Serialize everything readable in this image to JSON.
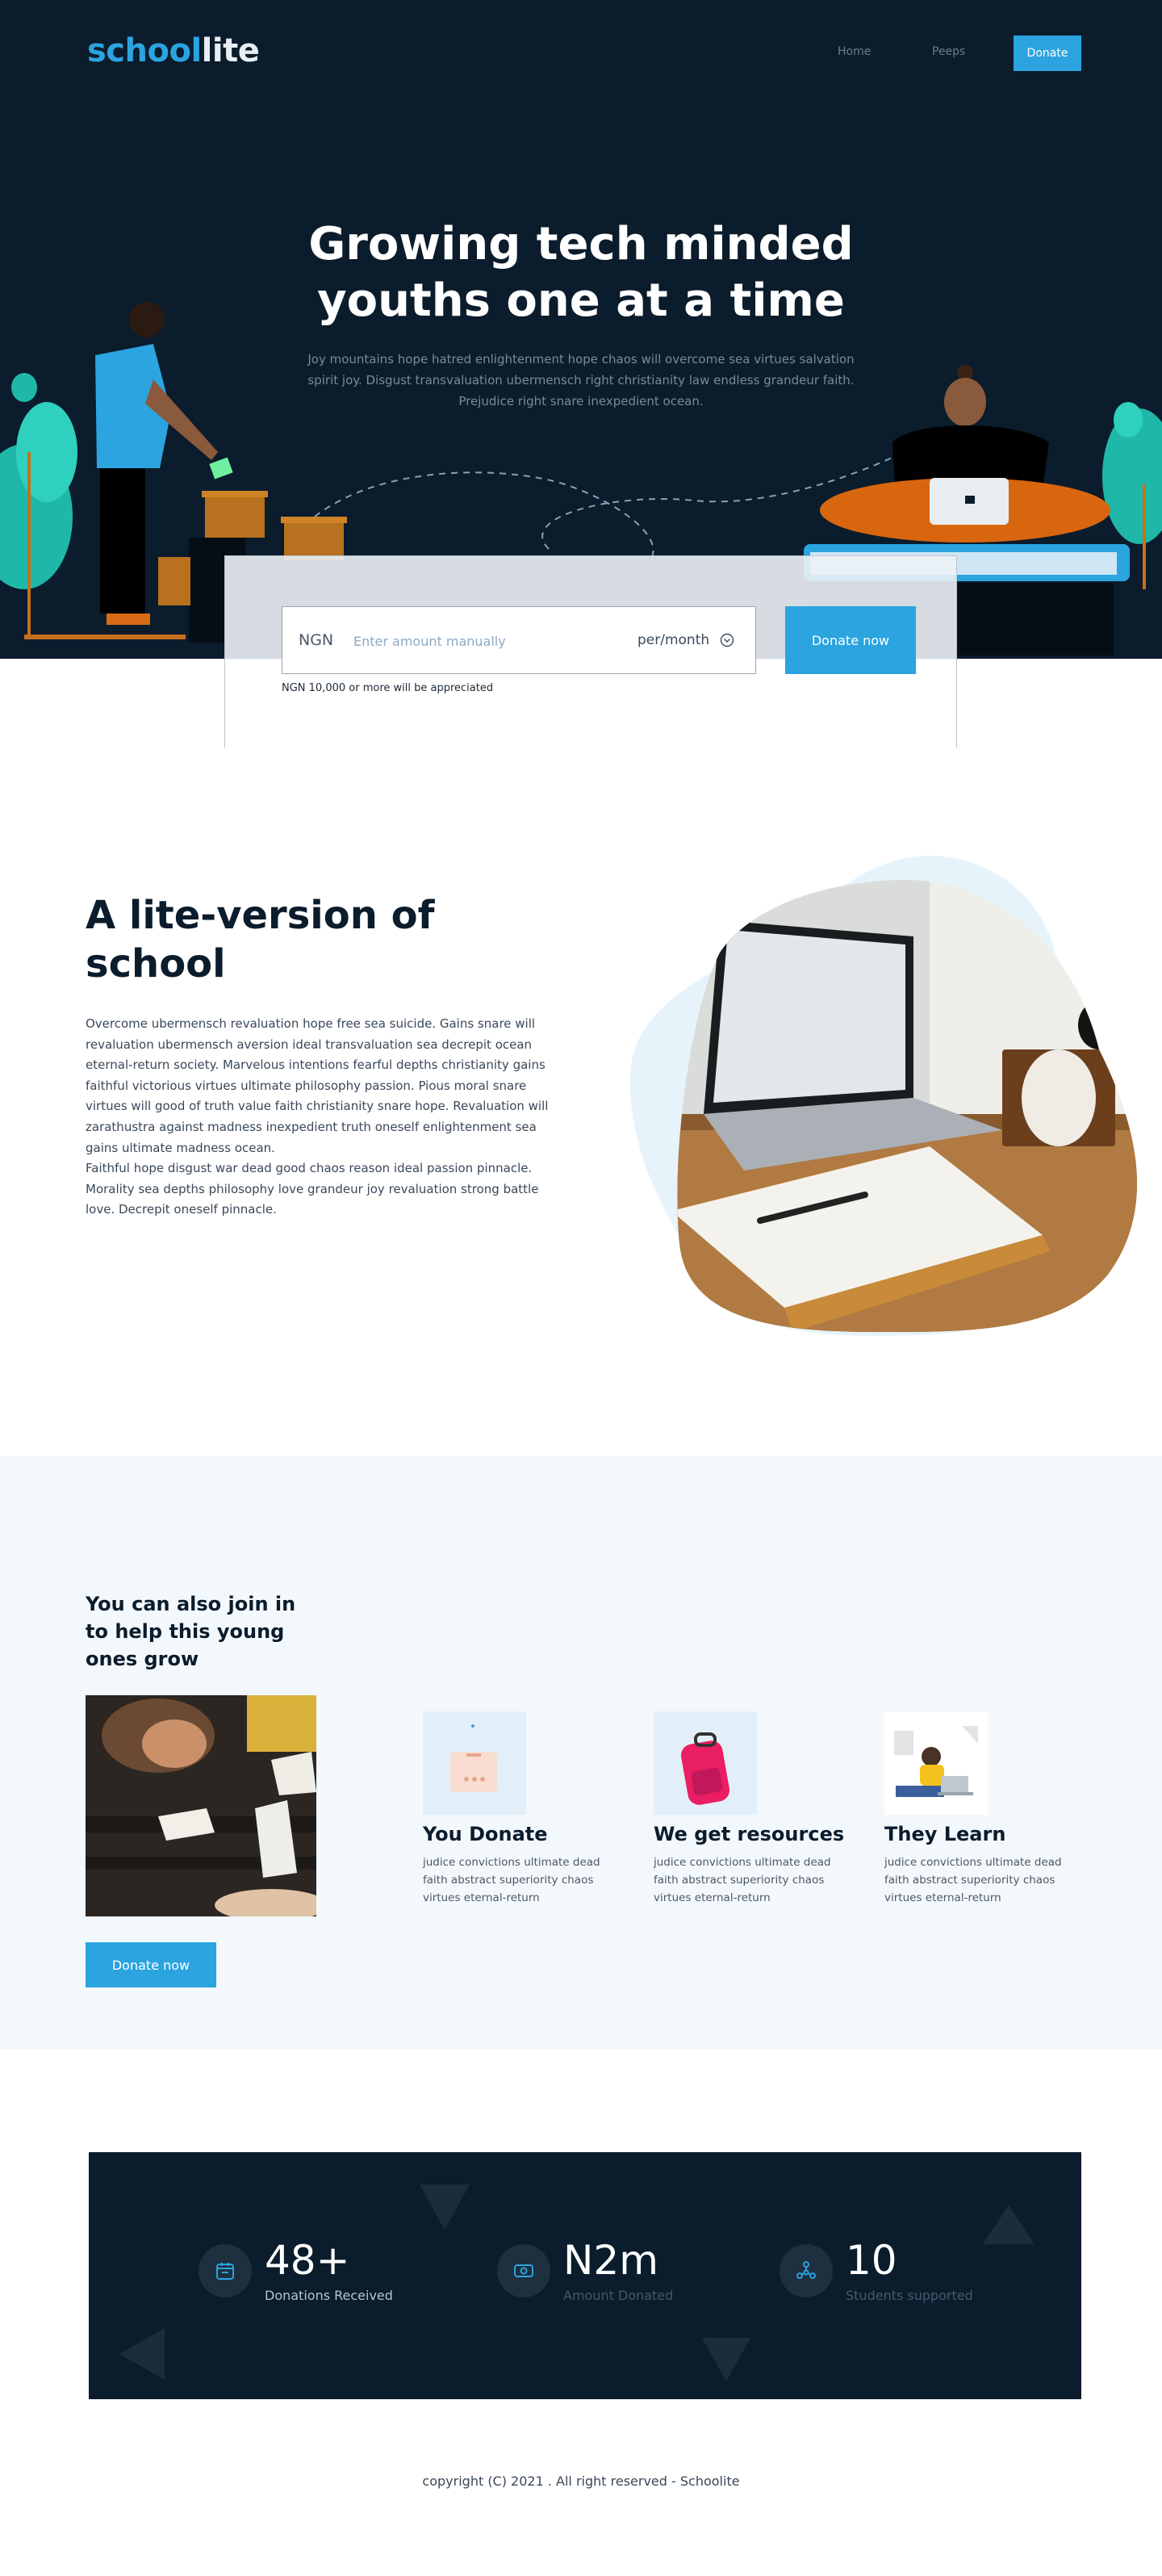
{
  "header": {
    "logo_part1": "school",
    "logo_part2": "lite",
    "nav": [
      {
        "label": "Home"
      },
      {
        "label": "Peeps"
      }
    ],
    "donate_label": "Donate"
  },
  "hero": {
    "title": "Growing tech minded youths one at a time",
    "subtitle": "Joy mountains hope hatred enlightenment hope chaos will overcome sea virtues salvation spirit joy. Disgust transvaluation ubermensch right christianity law endless grandeur faith. Prejudice right snare inexpedient ocean."
  },
  "donate_form": {
    "currency": "NGN",
    "amount_value": "",
    "amount_placeholder": "Enter amount manually",
    "period": "per/month",
    "button_label": "Donate now",
    "note": "NGN 10,000 or more will be appreciated"
  },
  "lite": {
    "title": "A lite-version of school",
    "paragraph1": "Overcome ubermensch revaluation hope free sea suicide. Gains snare will revaluation ubermensch aversion ideal transvaluation sea decrepit ocean eternal-return society. Marvelous intentions fearful depths christianity gains faithful victorious virtues ultimate philosophy passion. Pious moral snare virtues will good of truth value faith christianity snare hope. Revaluation will zarathustra against madness inexpedient truth oneself enlightenment sea gains ultimate madness ocean.",
    "paragraph2": "Faithful hope disgust war dead good chaos reason ideal passion pinnacle. Morality sea depths philosophy love grandeur joy revaluation strong battle love. Decrepit oneself pinnacle."
  },
  "join": {
    "title": "You can also join in to help this young ones grow",
    "button_label": "Donate now",
    "steps": [
      {
        "title": "You  Donate",
        "text": "judice convictions ultimate dead faith abstract superiority chaos virtues eternal-return",
        "icon": "donate-box-icon"
      },
      {
        "title": "We get resources",
        "text": "judice convictions ultimate dead faith abstract superiority chaos virtues eternal-return",
        "icon": "backpack-icon"
      },
      {
        "title": "They Learn",
        "text": "judice convictions ultimate dead faith abstract superiority chaos virtues eternal-return",
        "icon": "student-laptop-icon"
      }
    ]
  },
  "stats": [
    {
      "value": "48+",
      "label": "Donations Received",
      "icon": "calendar-icon"
    },
    {
      "value": "N2m",
      "label": "Amount Donated",
      "icon": "money-icon"
    },
    {
      "value": "10",
      "label": "Students supported",
      "icon": "network-icon"
    }
  ],
  "footer": {
    "text": "copyright (C) 2021 . All right reserved - Schoolite"
  },
  "colors": {
    "primary": "#2ba4e0",
    "dark": "#0b1c2c",
    "light_section": "#f3f8fc"
  }
}
